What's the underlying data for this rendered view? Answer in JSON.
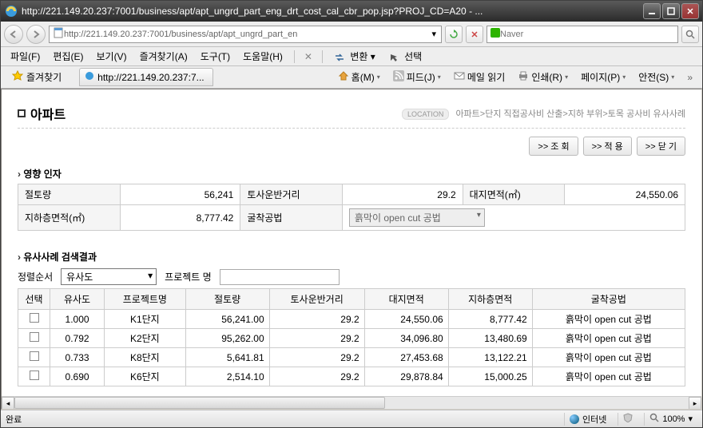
{
  "window": {
    "title": "http://221.149.20.237:7001/business/apt/apt_ungrd_part_eng_drt_cost_cal_cbr_pop.jsp?PROJ_CD=A20 - ..."
  },
  "address": {
    "url": "http://221.149.20.237:7001/business/apt/apt_ungrd_part_en"
  },
  "search": {
    "placeholder": "Naver"
  },
  "menu": {
    "file": "파일(F)",
    "edit": "편집(E)",
    "view": "보기(V)",
    "favorites": "즐겨찾기(A)",
    "tools": "도구(T)",
    "help": "도움말(H)",
    "convert": "변환",
    "select": "선택"
  },
  "toolbar": {
    "fav": "즐겨찾기",
    "tab_label": "http://221.149.20.237:7...",
    "home": "홈(M)",
    "feed": "피드(J)",
    "mail": "메일 읽기",
    "print": "인쇄(R)",
    "page": "페이지(P)",
    "safety": "안전(S)"
  },
  "page": {
    "title": "아파트",
    "location_label": "LOCATION",
    "location": "아파트>단지 직접공사비 산출>지하 부위>토목 공사비 유사사례",
    "btn_lookup": ">> 조 회",
    "btn_apply": ">> 적 용",
    "btn_close": ">> 닫 기",
    "section_factors": "영향 인자",
    "section_results": "유사사례 검색결과",
    "sort_label": "정렬순서",
    "sort_value": "유사도",
    "projname_label": "프로젝트 명"
  },
  "factors": {
    "lab1": "절토량",
    "val1": "56,241",
    "lab2": "토사운반거리",
    "val2": "29.2",
    "lab3": "대지면적(㎡)",
    "val3": "24,550.06",
    "lab4": "지하층면적(㎡)",
    "val4": "8,777.42",
    "lab5": "굴착공법",
    "val5": "흙막이 open cut 공법"
  },
  "cols": {
    "c0": "선택",
    "c1": "유사도",
    "c2": "프로젝트명",
    "c3": "절토량",
    "c4": "토사운반거리",
    "c5": "대지면적",
    "c6": "지하층면적",
    "c7": "굴착공법"
  },
  "rows": [
    {
      "sim": "1.000",
      "proj": "K1단지",
      "cut": "56,241.00",
      "dist": "29.2",
      "site": "24,550.06",
      "under": "8,777.42",
      "method": "흙막이 open cut 공법"
    },
    {
      "sim": "0.792",
      "proj": "K2단지",
      "cut": "95,262.00",
      "dist": "29.2",
      "site": "34,096.80",
      "under": "13,480.69",
      "method": "흙막이 open cut 공법"
    },
    {
      "sim": "0.733",
      "proj": "K8단지",
      "cut": "5,641.81",
      "dist": "29.2",
      "site": "27,453.68",
      "under": "13,122.21",
      "method": "흙막이 open cut 공법"
    },
    {
      "sim": "0.690",
      "proj": "K6단지",
      "cut": "2,514.10",
      "dist": "29.2",
      "site": "29,878.84",
      "under": "15,000.25",
      "method": "흙막이 open cut 공법"
    }
  ],
  "status": {
    "done": "완료",
    "internet": "인터넷",
    "zoom": "100%"
  }
}
